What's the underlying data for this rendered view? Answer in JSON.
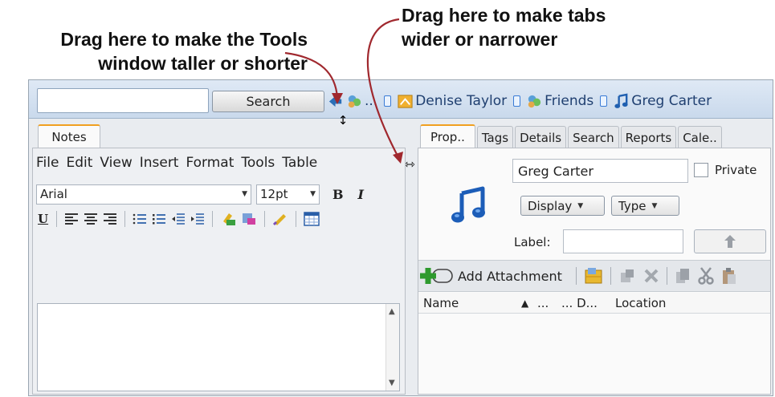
{
  "annotations": {
    "tools_height": [
      "Drag here to make the Tools",
      "window taller or shorter"
    ],
    "tabs_width": [
      "Drag here to make tabs",
      "wider or narrower"
    ]
  },
  "topbar": {
    "search_value": "",
    "search_button": "Search",
    "history_items": [
      {
        "label": "...",
        "icon": "contacts-group-icon"
      },
      {
        "label": "Denise Taylor",
        "icon": "contact-card-icon"
      },
      {
        "label": "Friends",
        "icon": "contacts-group-icon"
      },
      {
        "label": "Greg Carter",
        "icon": "music-note-icon"
      }
    ]
  },
  "left_pane": {
    "tab": "Notes",
    "menu": [
      "File",
      "Edit",
      "View",
      "Insert",
      "Format",
      "Tools",
      "Table"
    ],
    "font": "Arial",
    "font_size": "12pt",
    "bold": "B",
    "italic": "I",
    "underline": "U"
  },
  "right_pane": {
    "tabs": [
      "Prop..",
      "Tags",
      "Details",
      "Search",
      "Reports",
      "Cale.."
    ],
    "name_value": "Greg Carter",
    "private_label": "Private",
    "display_button": "Display",
    "type_button": "Type",
    "label_label": "Label:",
    "label_value": "",
    "add_attachment": "Add Attachment",
    "columns": {
      "name": "Name",
      "c2": "...",
      "c3": "... D...",
      "location": "Location"
    }
  },
  "colors": {
    "accent_orange": "#f0a020",
    "topbar_blue": "#c9d9ec",
    "arrow_red": "#a0282e"
  }
}
